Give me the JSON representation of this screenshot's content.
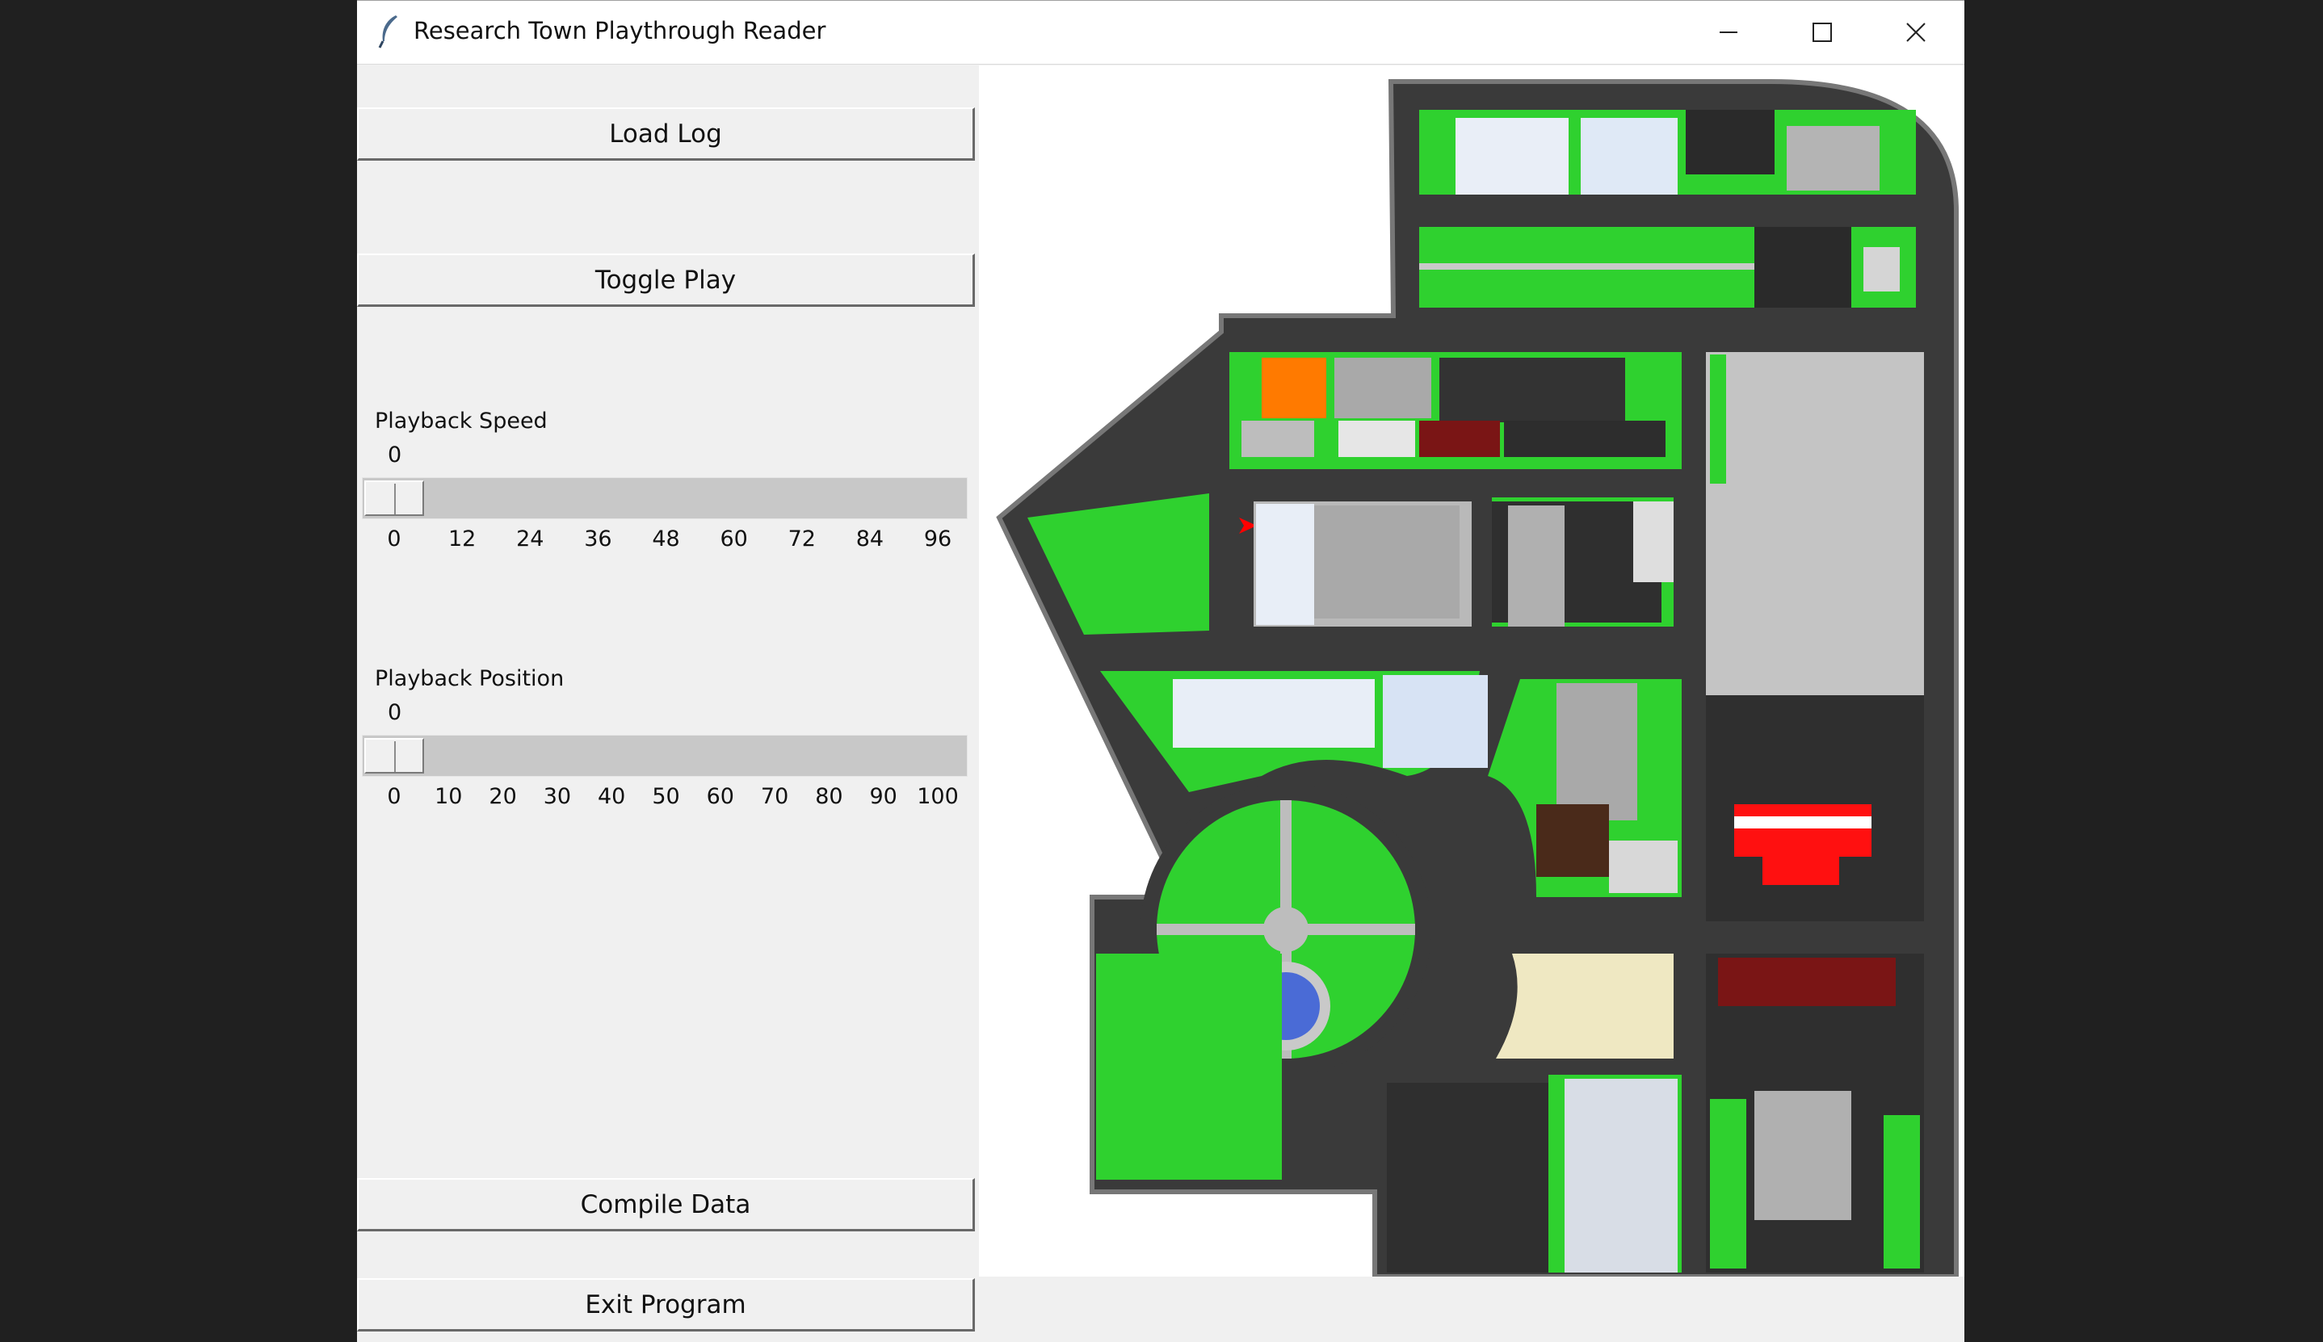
{
  "window": {
    "title": "Research Town Playthrough Reader",
    "icon": "feather-icon",
    "controls": [
      "minimize-icon",
      "maximize-icon",
      "close-icon"
    ]
  },
  "buttons": {
    "load_log": "Load Log",
    "toggle_play": "Toggle Play",
    "compile_data": "Compile Data",
    "exit_program": "Exit Program"
  },
  "speed": {
    "label": "Playback Speed",
    "value": "0",
    "ticks": [
      "0",
      "12",
      "24",
      "36",
      "48",
      "60",
      "72",
      "84",
      "96"
    ]
  },
  "position": {
    "label": "Playback Position",
    "value": "0",
    "ticks": [
      "0",
      "10",
      "20",
      "30",
      "40",
      "50",
      "60",
      "70",
      "80",
      "90",
      "100"
    ]
  },
  "map": {
    "description_icon": "town-map",
    "marker_icon": "player-arrow-icon",
    "colors": {
      "grass": "#2fd12f",
      "road": "#2f2f2f",
      "lane": "#d8c94a",
      "sidewalk": "#b9b9b9",
      "fountain": "#4a6bd6",
      "marker": "#ff0000"
    }
  }
}
